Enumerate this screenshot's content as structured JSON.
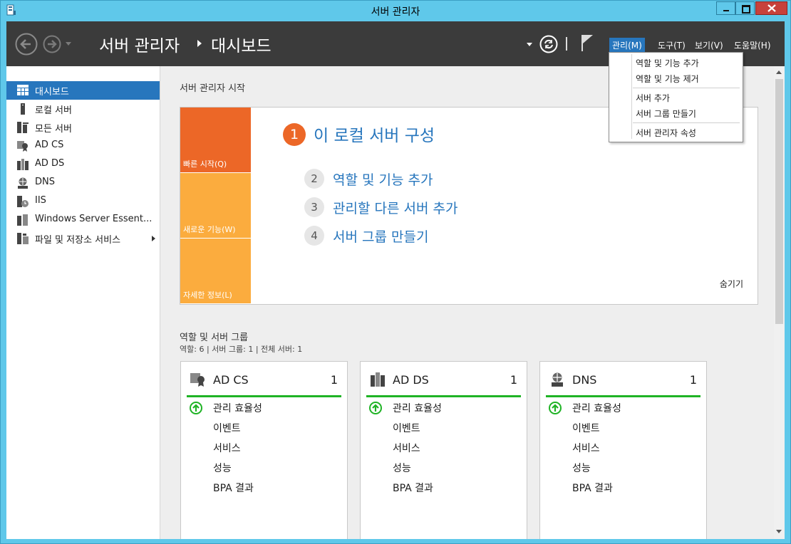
{
  "window": {
    "title": "서버 관리자"
  },
  "header": {
    "breadcrumb_root": "서버 관리자",
    "breadcrumb_current": "대시보드",
    "menus": [
      "관리(M)",
      "도구(T)",
      "보기(V)",
      "도움말(H)"
    ],
    "active_menu": "관리(M)"
  },
  "dropdown": {
    "items": [
      "역할 및 기능 추가",
      "역할 및 기능 제거",
      "서버 추가",
      "서버 그룹 만들기",
      "서버 관리자 속성"
    ]
  },
  "sidebar": {
    "items": [
      {
        "label": "대시보드",
        "icon": "dashboard-icon",
        "selected": true
      },
      {
        "label": "로컬 서버",
        "icon": "local-server-icon"
      },
      {
        "label": "모든 서버",
        "icon": "all-servers-icon"
      },
      {
        "label": "AD CS",
        "icon": "ad-cs-icon"
      },
      {
        "label": "AD DS",
        "icon": "ad-ds-icon"
      },
      {
        "label": "DNS",
        "icon": "dns-icon"
      },
      {
        "label": "IIS",
        "icon": "iis-icon"
      },
      {
        "label": "Windows Server Essent...",
        "icon": "windows-server-essentials-icon"
      },
      {
        "label": "파일 및 저장소 서비스",
        "icon": "file-storage-icon",
        "has_arrow": true
      }
    ]
  },
  "main": {
    "section_title": "서버 관리자 시작",
    "tiles": [
      "빠른 시작(Q)",
      "새로운 기능(W)",
      "자세한 정보(L)"
    ],
    "steps": [
      {
        "num": "1",
        "label": "이 로컬 서버 구성"
      },
      {
        "num": "2",
        "label": "역할 및 기능 추가"
      },
      {
        "num": "3",
        "label": "관리할 다른 서버 추가"
      },
      {
        "num": "4",
        "label": "서버 그룹 만들기"
      }
    ],
    "hide_label": "숨기기",
    "groups_title": "역할 및 서버 그룹",
    "groups_summary": "역할: 6   |   서버 그룹: 1   |   전체 서버: 1",
    "cards": [
      {
        "title": "AD CS",
        "count": "1",
        "rows": [
          "관리 효율성",
          "이벤트",
          "서비스",
          "성능",
          "BPA 결과"
        ]
      },
      {
        "title": "AD DS",
        "count": "1",
        "rows": [
          "관리 효율성",
          "이벤트",
          "서비스",
          "성능",
          "BPA 결과"
        ]
      },
      {
        "title": "DNS",
        "count": "1",
        "rows": [
          "관리 효율성",
          "이벤트",
          "서비스",
          "성능",
          "BPA 결과"
        ]
      }
    ]
  },
  "colors": {
    "accent": "#2776bd",
    "orange": "#ec6727",
    "amber": "#fbac3e",
    "ok_green": "#1fb325",
    "chrome": "#5fc8ea",
    "header": "#3b3b3b"
  }
}
